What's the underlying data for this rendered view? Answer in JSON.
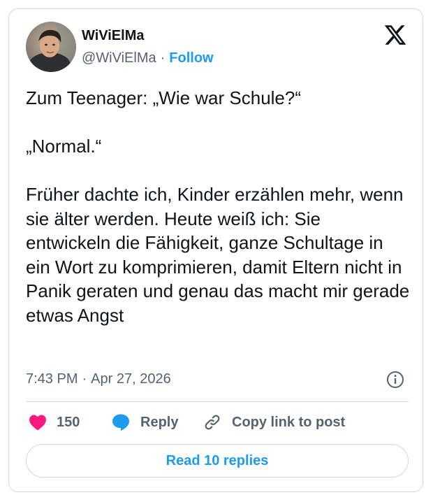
{
  "author": {
    "display_name": "WiViElMa",
    "handle": "@WiViElMa",
    "separator": "·",
    "follow_label": "Follow"
  },
  "tweet": {
    "text": "Zum Teenager: „Wie war Schule?“\n\n„Normal.“\n\nFrüher dachte ich, Kinder erzählen mehr, wenn sie älter werden. Heute weiß ich: Sie entwickeln die Fähigkeit, ganze Schultage in ein Wort zu komprimieren, damit Eltern nicht in Panik geraten und genau das macht mir gerade etwas Angst",
    "time": "7:43 PM",
    "separator": "·",
    "date": "Apr 27, 2026"
  },
  "actions": {
    "like_count": "150",
    "reply_label": "Reply",
    "copy_label": "Copy link to post"
  },
  "read_replies_label": "Read 10 replies",
  "icons": {
    "logo": "x-logo-icon",
    "info": "info-icon",
    "like": "heart-icon",
    "reply": "speech-bubble-icon",
    "copy": "link-icon"
  },
  "colors": {
    "accent": "#1d9bf0",
    "like": "#f91880",
    "secondary_text": "#536471",
    "border": "#cfd9de"
  }
}
